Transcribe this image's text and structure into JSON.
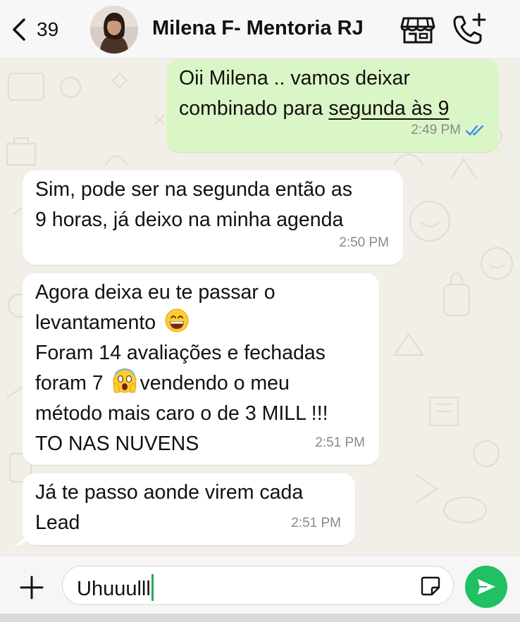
{
  "header": {
    "back_count": "39",
    "contact_name": "Milena F- Mentoria RJ",
    "icons": [
      "chevron-left-icon",
      "store-icon",
      "add-call-icon"
    ]
  },
  "messages": [
    {
      "direction": "outgoing",
      "lines": [
        "Oii Milena .. vamos deixar",
        "combinado para "
      ],
      "link_text": "segunda às 9",
      "time": "2:49 PM",
      "status": "read"
    },
    {
      "direction": "incoming",
      "lines": [
        "Sim, pode ser na segunda então as",
        "9 horas, já deixo na minha agenda"
      ],
      "time": "2:50 PM"
    },
    {
      "direction": "incoming",
      "lines": [
        "Agora deixa eu te passar o",
        "levantamento",
        "Foram 14 avaliações e fechadas",
        "foram 7",
        "vendendo o meu",
        "método mais caro o de 3 MILL !!!",
        "TO NAS NUVENS"
      ],
      "emojis": [
        "grinning-face-icon",
        "screaming-face-icon"
      ],
      "time": "2:51 PM"
    },
    {
      "direction": "incoming",
      "lines": [
        "Já te passo aonde virem cada",
        "Lead"
      ],
      "time": "2:51 PM"
    }
  ],
  "composer": {
    "value": "Uhuuulll",
    "icons": [
      "plus-icon",
      "sticker-icon",
      "send-icon"
    ]
  },
  "colors": {
    "outgoing_bubble": "#dbf6c6",
    "incoming_bubble": "#ffffff",
    "wallpaper": "#f2efe8",
    "send_button": "#21c063",
    "read_ticks": "#3a91e6"
  }
}
